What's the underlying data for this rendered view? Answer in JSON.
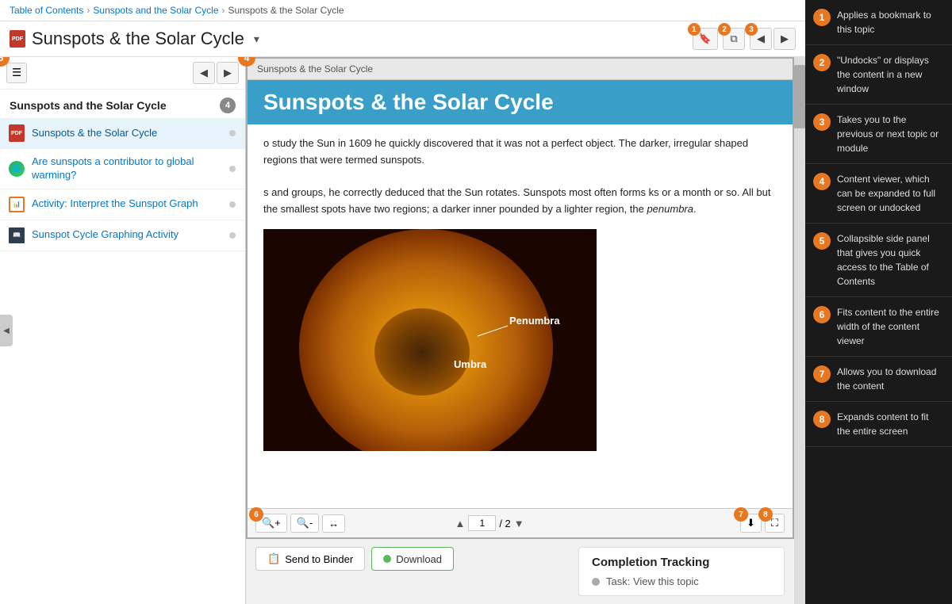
{
  "breadcrumb": {
    "items": [
      "Table of Contents",
      "Sunspots and the Solar Cycle",
      "Sunspots & the Solar Cycle"
    ]
  },
  "title": {
    "text": "Sunspots & the Solar Cycle",
    "dropdown_label": "▾"
  },
  "toolbar": {
    "bookmark_label": "🔖",
    "undock_label": "⧉",
    "prev_label": "◀",
    "next_label": "▶"
  },
  "side_panel": {
    "section_title": "Sunspots and the Solar Cycle",
    "section_count": "4",
    "items": [
      {
        "label": "Sunspots & the Solar Cycle",
        "type": "pdf",
        "active": true
      },
      {
        "label": "Are sunspots a contributor to global warming?",
        "type": "globe",
        "active": false
      },
      {
        "label": "Activity: Interpret the Sunspot Graph",
        "type": "activity",
        "active": false
      },
      {
        "label": "Sunspot Cycle Graphing Activity",
        "type": "book",
        "active": false
      }
    ]
  },
  "content": {
    "header": "Sunspots & the Solar Cycle",
    "title": "Sunspots & the Solar Cycle",
    "paragraphs": [
      "o study the Sun in 1609 he quickly discovered that it was not a perfect object. The darker, irregular shaped regions that were termed sunspots.",
      "s and groups, he correctly deduced that the Sun rotates. Sunspots most often forms ks or a month or so. All but the smallest spots have two regions; a darker inner pounded by a lighter region, the penumbra."
    ],
    "image_labels": [
      "Penumbra",
      "Umbra"
    ]
  },
  "bottom_toolbar": {
    "zoom_in": "+🔍",
    "zoom_out": "-🔍",
    "fit_width": "↔",
    "page_current": "1",
    "page_total": "2",
    "download_icon": "⬇",
    "fullscreen_icon": "⛶"
  },
  "actions": {
    "binder_label": "Send to Binder",
    "download_label": "Download"
  },
  "completion": {
    "title": "Completion Tracking",
    "task_label": "Task: View this topic"
  },
  "annotations": [
    {
      "num": "1",
      "text": "Applies a bookmark to this topic"
    },
    {
      "num": "2",
      "text": "\"Undocks\" or displays the content in a new window"
    },
    {
      "num": "3",
      "text": "Takes you to the previous or next topic or module"
    },
    {
      "num": "4",
      "text": "Content viewer, which can be expanded to full screen or undocked"
    },
    {
      "num": "5",
      "text": "Collapsible side panel that gives you quick access to the Table of Contents"
    },
    {
      "num": "6",
      "text": "Fits content to the entire width of the content viewer"
    },
    {
      "num": "7",
      "text": "Allows you to download the content"
    },
    {
      "num": "8",
      "text": "Expands content to fit the entire screen"
    }
  ]
}
